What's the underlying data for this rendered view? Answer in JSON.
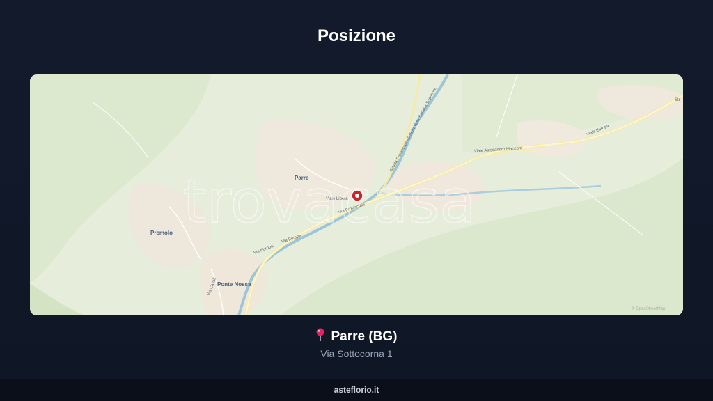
{
  "header": {
    "title": "Posizione"
  },
  "map": {
    "watermark": "trovacasa",
    "attribution": "© OpenStreetMap",
    "places": {
      "parre": "Parre",
      "premolo": "Premolo",
      "ponte_nossa": "Ponte Nossa"
    },
    "roads": {
      "viale_libera": "Viale Libera",
      "via_provinciale": "Via Provinciale",
      "via_europa_1": "Via Europa",
      "via_europa_2": "Via Europa",
      "via_europa_3": "Viale Europa",
      "strada_provinciale": "Strada Provinciale 49 della Valle Seriana Superiore",
      "viale_manzoni": "Viale Alessandro Manzoni",
      "via_carrali": "Via Cavali",
      "str_label": "Str"
    },
    "marker_icon": "location-marker-icon",
    "colors": {
      "land": "#e8eedd",
      "forest": "#d8e6c8",
      "urban": "#f2ebe0",
      "river": "#9cc6d8",
      "road": "#fdf3c2",
      "marker": "#c9252d"
    }
  },
  "location": {
    "pin_icon": "pin-icon",
    "name": "Parre (BG)",
    "address": "Via Sottocorna 1"
  },
  "footer": {
    "brand": "asteflorio.it"
  }
}
